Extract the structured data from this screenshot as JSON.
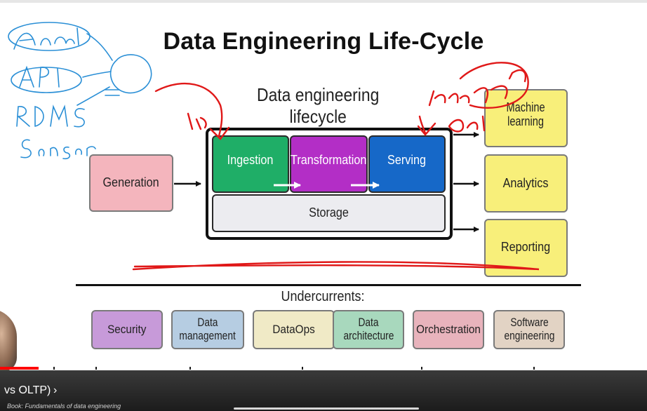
{
  "slide": {
    "title": "Data Engineering Life-Cycle",
    "lifecycle_heading": "Data engineering lifecycle",
    "generation": "Generation",
    "stages": {
      "ingestion": "Ingestion",
      "transformation": "Transformation",
      "serving": "Serving",
      "storage": "Storage"
    },
    "outputs": {
      "ml_line1": "Machine",
      "ml_line2": "learning",
      "analytics": "Analytics",
      "reporting": "Reporting"
    },
    "undercurrents_heading": "Undercurrents:",
    "undercurrents": {
      "security": "Security",
      "data_management_1": "Data",
      "data_management_2": "management",
      "dataops": "DataOps",
      "data_architecture_1": "Data",
      "data_architecture_2": "architecture",
      "orchestration": "Orchestration",
      "software_engineering_1": "Software",
      "software_engineering_2": "engineering"
    }
  },
  "colors": {
    "generation": "#f4b5bd",
    "ingestion": "#1fae67",
    "transformation": "#b32ec6",
    "serving": "#1668c8",
    "storage": "#ececf0",
    "output": "#f8ef7a",
    "annotation_blue": "#2a8fd6",
    "annotation_red": "#e01818",
    "progress_red": "#ff0000"
  },
  "player": {
    "chapter_title": "vs OLTP)",
    "chapter_chevron": "›",
    "book_caption": "Book: Fundamentals of data engineering",
    "progress": 0.06
  }
}
